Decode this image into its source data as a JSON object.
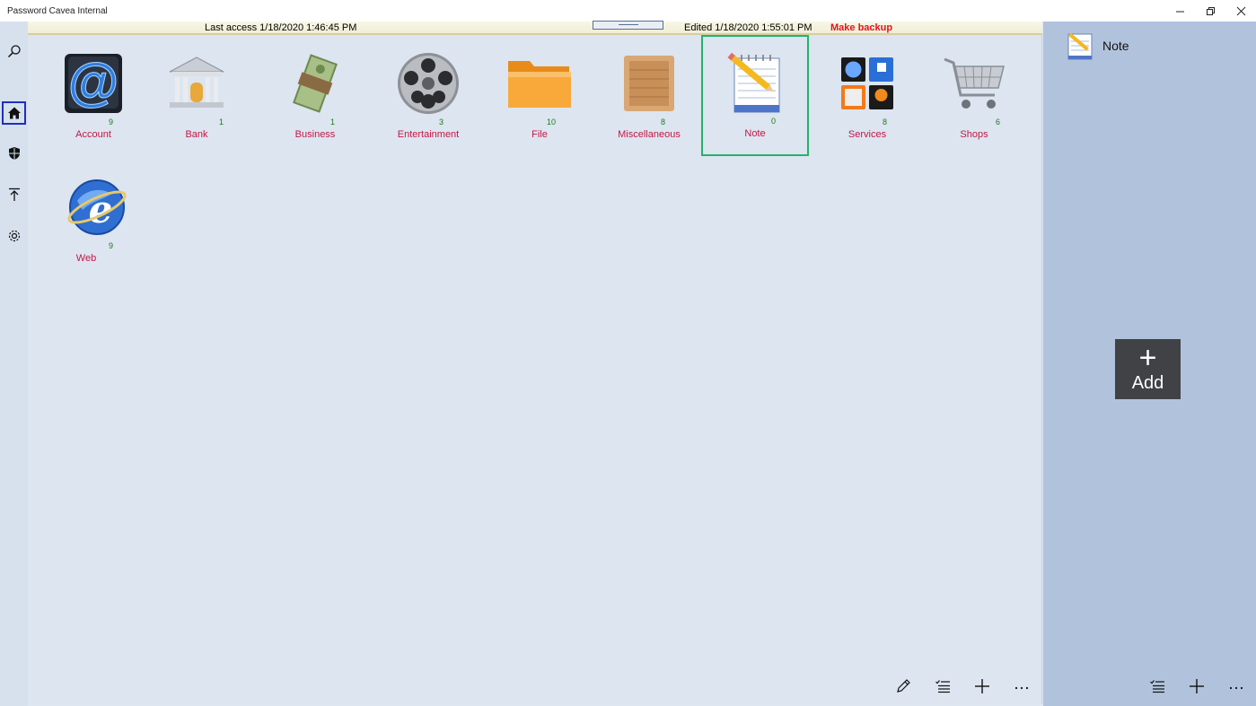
{
  "window": {
    "title": "Password Cavea Internal",
    "minimize": "–",
    "restore": "❐",
    "close": "✕"
  },
  "infobar": {
    "last_access": "Last access   1/18/2020   1:46:45 PM",
    "edited": "Edited   1/18/2020   1:55:01 PM",
    "backup": "Make backup"
  },
  "categories": [
    {
      "label": "Account",
      "count": "9",
      "icon": "at-sign-icon"
    },
    {
      "label": "Bank",
      "count": "1",
      "icon": "bank-icon"
    },
    {
      "label": "Business",
      "count": "1",
      "icon": "money-icon"
    },
    {
      "label": "Entertainment",
      "count": "3",
      "icon": "film-reel-icon"
    },
    {
      "label": "File",
      "count": "10",
      "icon": "folder-icon"
    },
    {
      "label": "Miscellaneous",
      "count": "8",
      "icon": "crate-icon"
    },
    {
      "label": "Note",
      "count": "0",
      "icon": "notepad-icon"
    },
    {
      "label": "Services",
      "count": "8",
      "icon": "utilities-icon"
    },
    {
      "label": "Shops",
      "count": "6",
      "icon": "shopping-cart-icon"
    },
    {
      "label": "Web",
      "count": "9",
      "icon": "globe-icon"
    }
  ],
  "selected_category": "Note",
  "right_pane": {
    "title": "Note",
    "add_label": "Add",
    "add_symbol": "+"
  },
  "colors": {
    "label": "#c41745",
    "count": "#1e7a1e",
    "selection": "#22b36a",
    "backup": "#e0141c"
  }
}
